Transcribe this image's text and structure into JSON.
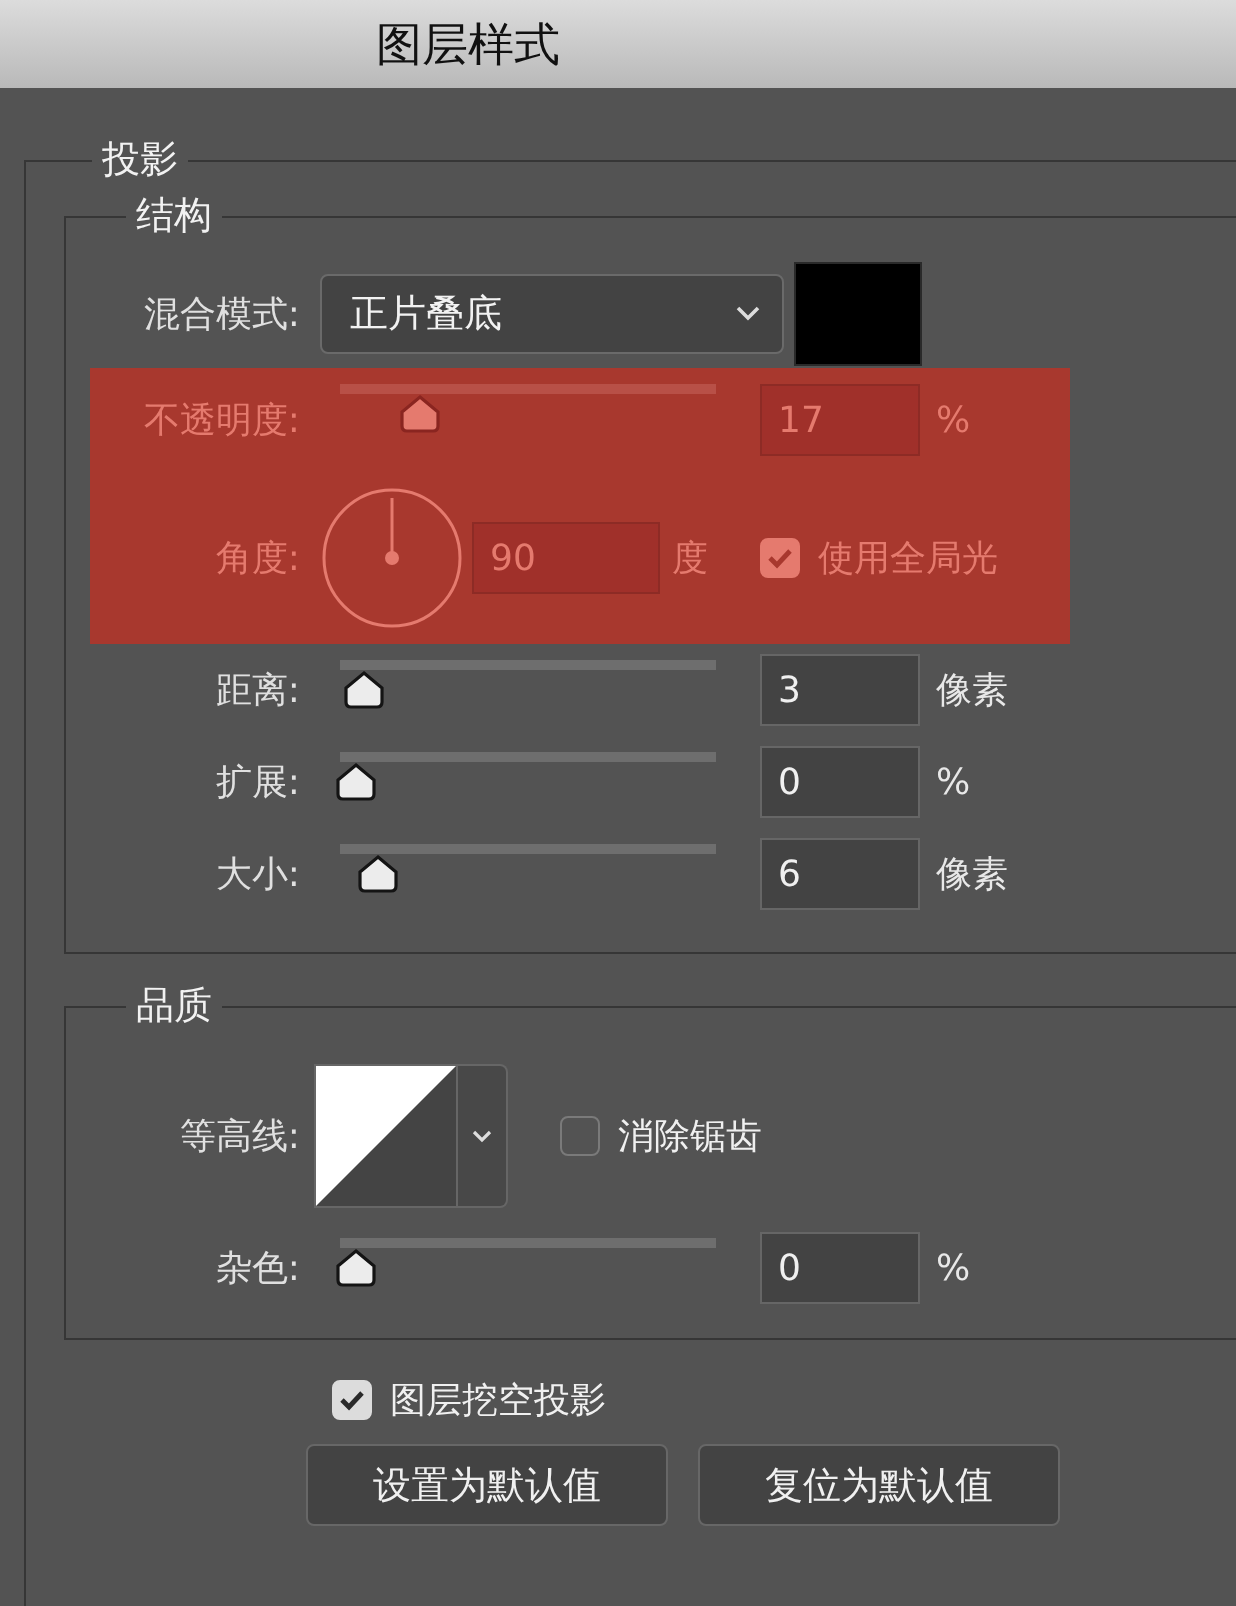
{
  "window": {
    "title": "图层样式"
  },
  "section": {
    "title": "投影",
    "structure": {
      "title": "结构",
      "blend_mode": {
        "label": "混合模式:",
        "value": "正片叠底",
        "color": "#000000"
      },
      "rows": [
        {
          "kind": "slider",
          "label": "不透明度:",
          "level": 0.17,
          "value": "17",
          "unit": "%",
          "highlighted": true
        },
        {
          "kind": "angle",
          "label": "角度:",
          "value": "90",
          "unit": "度",
          "global_light": {
            "label": "使用全局光",
            "checked": true
          },
          "highlighted": true
        },
        {
          "kind": "slider",
          "label": "距离:",
          "level": 0.02,
          "value": "3",
          "unit": "像素",
          "highlighted": false
        },
        {
          "kind": "slider",
          "label": "扩展:",
          "level": 0,
          "value": "0",
          "unit": "%",
          "highlighted": false
        },
        {
          "kind": "slider",
          "label": "大小:",
          "level": 0.06,
          "value": "6",
          "unit": "像素",
          "highlighted": false
        }
      ]
    },
    "quality": {
      "title": "品质",
      "contour": {
        "label": "等高线:",
        "anti_alias": {
          "label": "消除锯齿",
          "checked": false
        }
      },
      "rows": [
        {
          "kind": "slider",
          "label": "杂色:",
          "level": 0,
          "value": "0",
          "unit": "%",
          "highlighted": false
        }
      ]
    },
    "knockout": {
      "label": "图层挖空投影",
      "checked": true
    },
    "buttons": [
      "设置为默认值",
      "复位为默认值"
    ]
  }
}
